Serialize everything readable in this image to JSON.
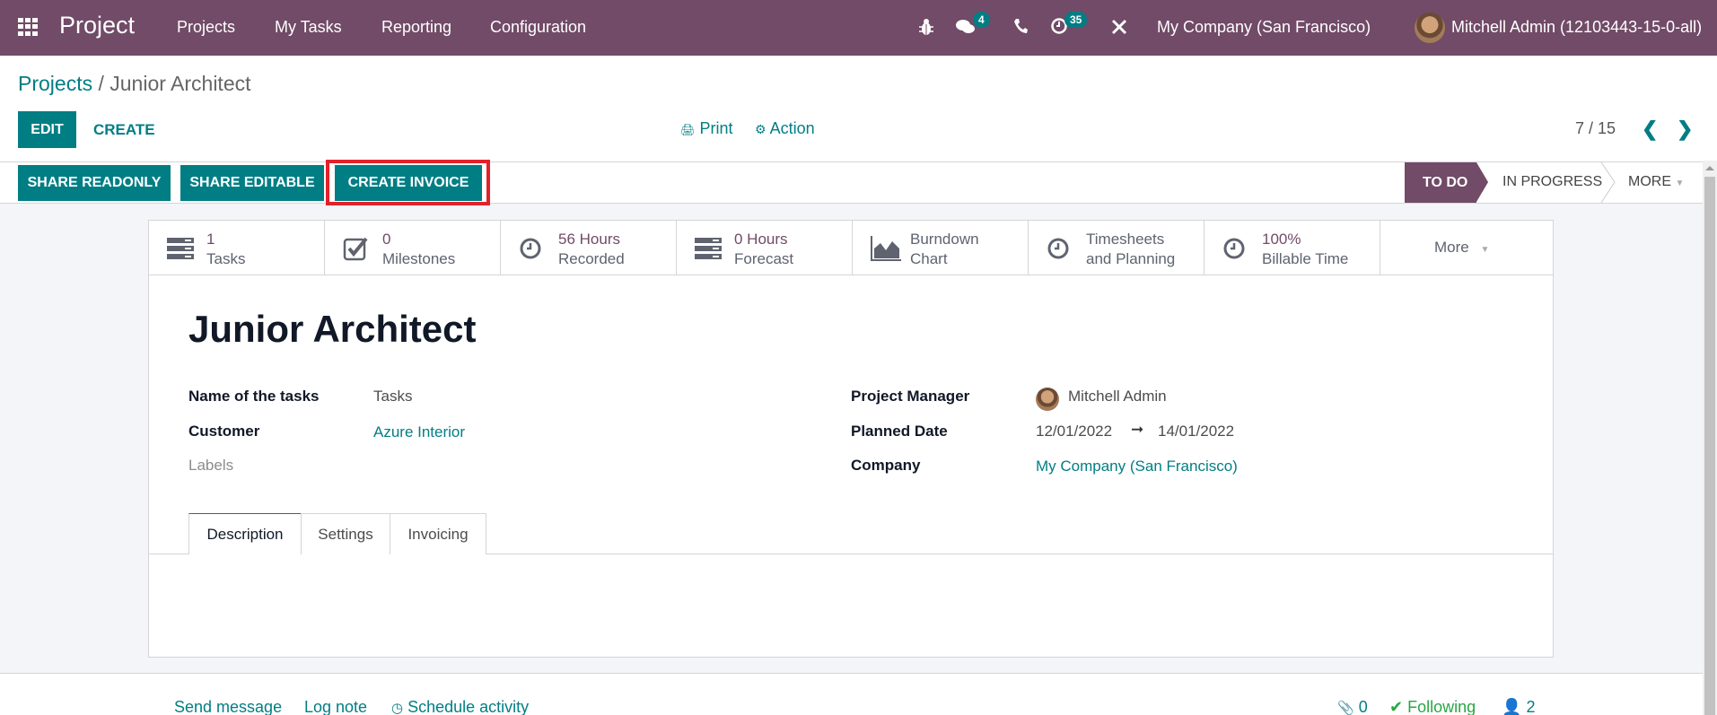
{
  "navbar": {
    "app_name": "Project",
    "menu": [
      "Projects",
      "My Tasks",
      "Reporting",
      "Configuration"
    ],
    "icons": [
      "bug-icon",
      "chat-icon",
      "phone-icon",
      "activity-clock-icon",
      "tools-icon"
    ],
    "messages_count": "4",
    "activities_count": "35",
    "company": "My Company (San Francisco)",
    "user": "Mitchell Admin (12103443-15-0-all)"
  },
  "breadcrumb": {
    "parent": "Projects",
    "separator": "/",
    "current": "Junior Architect"
  },
  "control_panel": {
    "edit_label": "EDIT",
    "create_label": "CREATE",
    "print_label": "Print",
    "action_label": "Action",
    "pager": "7 / 15"
  },
  "statusbar": {
    "buttons": [
      "SHARE READONLY",
      "SHARE EDITABLE",
      "CREATE INVOICE"
    ],
    "highlighted": "CREATE INVOICE",
    "stages": [
      "TO DO",
      "IN PROGRESS"
    ],
    "active_stage": "TO DO",
    "more_label": "MORE"
  },
  "stat_buttons": [
    {
      "value": "1",
      "label": "Tasks",
      "icon": "tasks-icon"
    },
    {
      "value": "0",
      "label": "Milestones",
      "icon": "checkbox-icon"
    },
    {
      "value": "56 Hours",
      "label": "Recorded",
      "icon": "clock-icon"
    },
    {
      "value": "0 Hours",
      "label": "Forecast",
      "icon": "tasks-icon"
    },
    {
      "value": "Burndown",
      "label": "Chart",
      "icon": "area-chart-icon"
    },
    {
      "value": "Timesheets",
      "label": "and Planning",
      "icon": "clock-icon"
    },
    {
      "value": "100%",
      "label": "Billable Time",
      "icon": "clock-icon"
    }
  ],
  "stat_more": "More",
  "form": {
    "title": "Junior Architect",
    "left_fields": [
      {
        "label": "Name of the tasks",
        "value": "Tasks"
      },
      {
        "label": "Customer",
        "value": "Azure Interior"
      },
      {
        "label": "Labels",
        "value": ""
      }
    ],
    "right_fields": [
      {
        "label": "Project Manager",
        "value": "Mitchell Admin"
      },
      {
        "label": "Planned Date",
        "value_from": "12/01/2022",
        "arrow": "➞",
        "value_to": "14/01/2022"
      },
      {
        "label": "Company",
        "value": "My Company (San Francisco)"
      }
    ],
    "tabs": [
      "Description",
      "Settings",
      "Invoicing"
    ],
    "active_tab": "Description"
  },
  "chatter": {
    "send_message": "Send message",
    "log_note": "Log note",
    "schedule_activity": "Schedule activity",
    "attachments": "0",
    "following": "Following",
    "followers": "2"
  },
  "colors": {
    "brand": "#714b67",
    "primary": "#017e84",
    "highlight": "#e3212a"
  }
}
